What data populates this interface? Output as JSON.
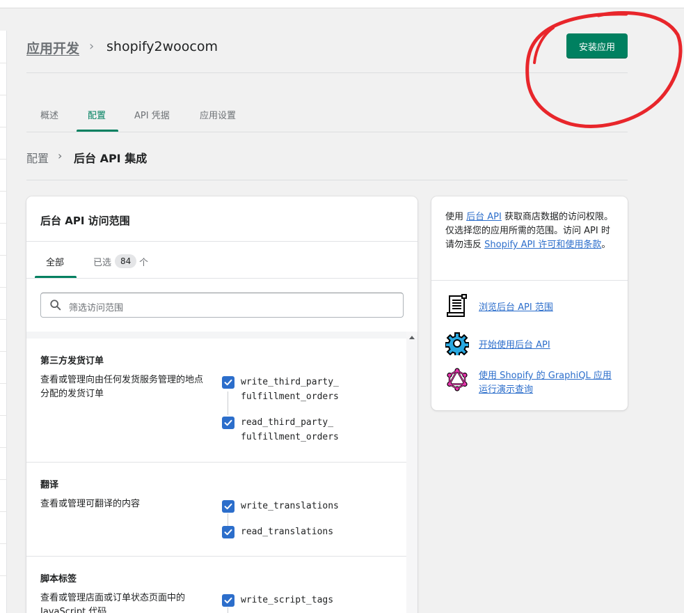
{
  "header": {
    "breadcrumb_link": "应用开发",
    "breadcrumb_sep": "›",
    "title": "shopify2woocom",
    "install_button": "安装应用"
  },
  "tabs": [
    {
      "label": "概述",
      "active": false
    },
    {
      "label": "配置",
      "active": true
    },
    {
      "label": "API 凭据",
      "active": false
    },
    {
      "label": "应用设置",
      "active": false
    }
  ],
  "sub_breadcrumb": {
    "link": "配置",
    "sep": "›",
    "current": "后台 API 集成"
  },
  "scopes_card": {
    "title": "后台 API 访问范围",
    "tab_all": "全部",
    "tab_selected": "已选",
    "selected_count": "84",
    "selected_unit": "个",
    "search_placeholder": "筛选访问范围",
    "sections": [
      {
        "title": "第三方发货订单",
        "description": "查看或管理向由任何发货服务管理的地点分配的发货订单",
        "scopes": [
          "write_third_party_\nfulfillment_orders",
          "read_third_party_\nfulfillment_orders"
        ]
      },
      {
        "title": "翻译",
        "description": "查看或管理可翻译的内容",
        "scopes": [
          "write_translations",
          "read_translations"
        ]
      },
      {
        "title": "脚本标签",
        "description": "查看或管理店面或订单状态页面中的 JavaScript 代码",
        "scopes": [
          "write_script_tags"
        ]
      }
    ]
  },
  "info_card": {
    "text_1": "使用 ",
    "link_1": "后台 API",
    "text_2": " 获取商店数据的访问权限。仅选择您的应用所需的范围。访问 API 时请勿违反 ",
    "link_2": "Shopify API 许可和使用条款",
    "text_3": "。",
    "resources": [
      {
        "icon": "document-scroll-icon",
        "label": "浏览后台 API 范围"
      },
      {
        "icon": "gear-icon",
        "label": "开始使用后台 API"
      },
      {
        "icon": "graphql-logo-icon",
        "label": "使用 Shopify 的 GraphiQL 应用运行演示查询"
      }
    ]
  },
  "colors": {
    "primary": "#008060",
    "link": "#2c6ecb",
    "checkbox": "#2c6ecb",
    "annotation": "#e8262b"
  },
  "annotation": {
    "shape": "hand-drawn red circle around install button"
  }
}
